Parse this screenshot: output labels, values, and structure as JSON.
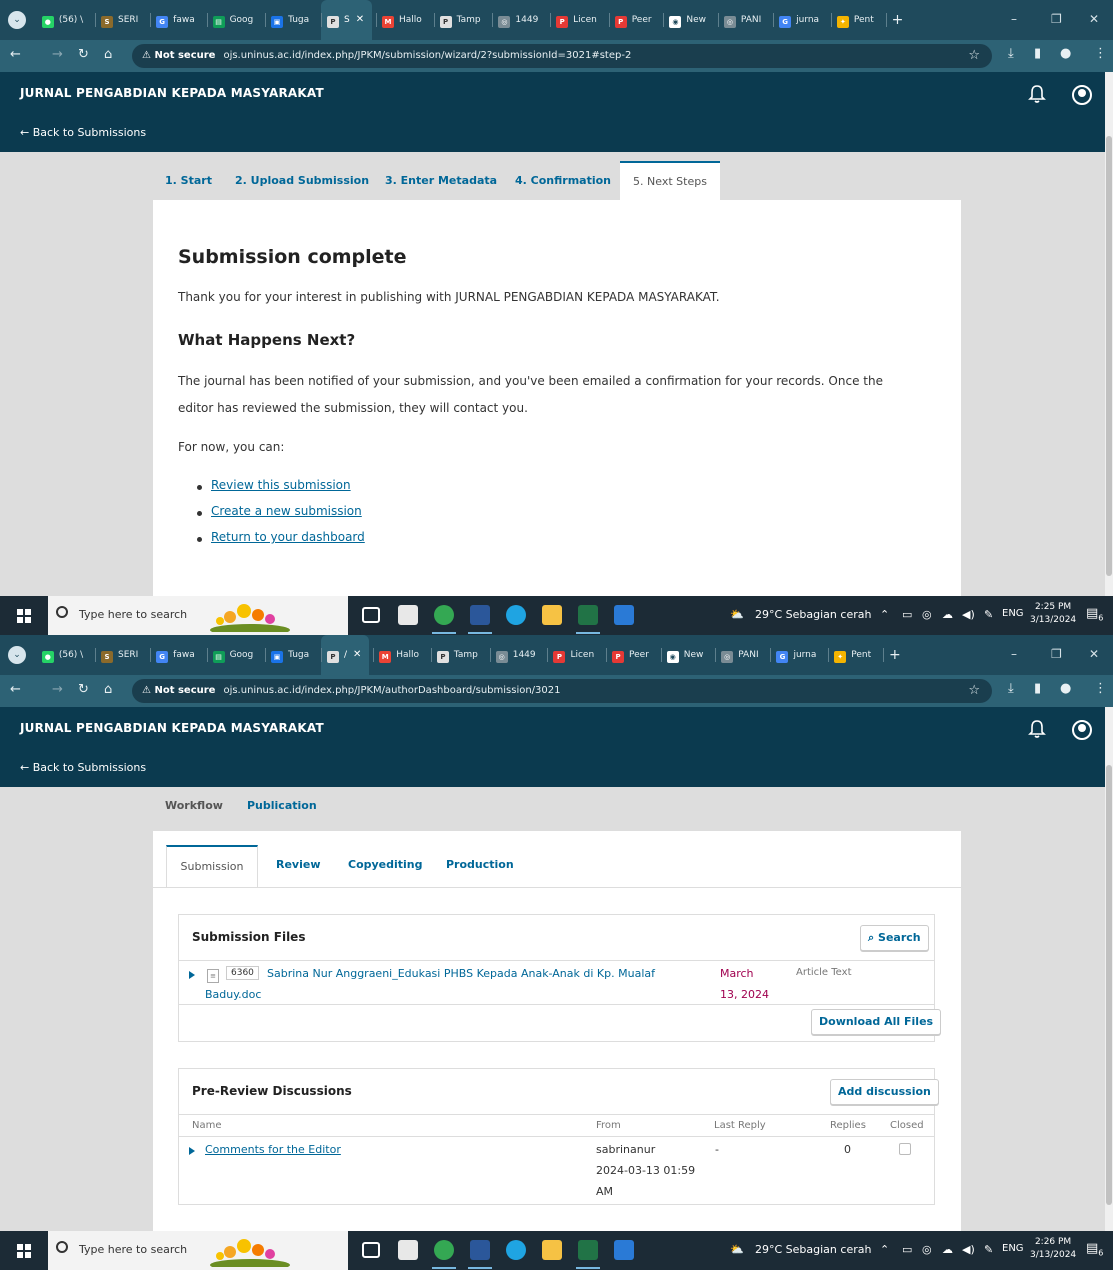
{
  "browser_tabs": [
    {
      "label": "(56) \\",
      "color": "#25d366",
      "glyph": "56"
    },
    {
      "label": "SERI",
      "color": "#8b6a2b",
      "glyph": "S"
    },
    {
      "label": "fawa",
      "color": "#4285f4",
      "glyph": "G"
    },
    {
      "label": "Goog",
      "color": "#0f9d58",
      "glyph": "G"
    },
    {
      "label": "Tuga",
      "color": "#1a73e8",
      "glyph": "T"
    },
    {
      "label": "",
      "color": "#e0e0e0",
      "glyph": "PKP",
      "active": true
    },
    {
      "label": "Hallo",
      "color": "#ea4335",
      "glyph": "M"
    },
    {
      "label": "Tamp",
      "color": "#e0e0e0",
      "glyph": "PKP"
    },
    {
      "label": "1449",
      "color": "#7a8c95",
      "glyph": "◎"
    },
    {
      "label": "Licen",
      "color": "#e53935",
      "glyph": "P"
    },
    {
      "label": "Peer",
      "color": "#e53935",
      "glyph": "P"
    },
    {
      "label": "New",
      "color": "#ffffff",
      "glyph": "◉"
    },
    {
      "label": "PANI",
      "color": "#7a8c95",
      "glyph": "◎"
    },
    {
      "label": "jurna",
      "color": "#4285f4",
      "glyph": "G"
    },
    {
      "label": "Pent",
      "color": "#f4b400",
      "glyph": "✦"
    }
  ],
  "shot1": {
    "active_tab_label": "S",
    "address": {
      "warning": "Not secure",
      "url": "ojs.uninus.ac.id/index.php/JPKM/submission/wizard/2?submissionId=3021#step-2"
    },
    "site_title": "JURNAL PENGABDIAN KEPADA MASYARAKAT",
    "back_link": "← Back to Submissions",
    "wizard_tabs": [
      "1. Start",
      "2. Upload Submission",
      "3. Enter Metadata",
      "4. Confirmation",
      "5. Next Steps"
    ],
    "heading": "Submission complete",
    "thanks": "Thank you for your interest in publishing with JURNAL PENGABDIAN KEPADA MASYARAKAT.",
    "subheading": "What Happens Next?",
    "body": "The journal has been notified of your submission, and you've been emailed a confirmation for your records. Once the editor has reviewed the submission, they will contact you.",
    "for_now": "For now, you can:",
    "links": [
      "Review this submission",
      "Create a new submission",
      "Return to your dashboard"
    ],
    "clock_time": "2:25 PM",
    "clock_date": "3/13/2024"
  },
  "shot2": {
    "active_tab_label": "/",
    "address": {
      "warning": "Not secure",
      "url": "ojs.uninus.ac.id/index.php/JPKM/authorDashboard/submission/3021"
    },
    "site_title": "JURNAL PENGABDIAN KEPADA MASYARAKAT",
    "back_link": "← Back to Submissions",
    "top_tabs": [
      "Workflow",
      "Publication"
    ],
    "stage_tabs": [
      "Submission",
      "Review",
      "Copyediting",
      "Production"
    ],
    "files": {
      "title": "Submission Files",
      "search": "Search",
      "file_id": "6360",
      "file_name_line1": "Sabrina Nur Anggraeni_Edukasi PHBS Kepada Anak-Anak di Kp. Mualaf",
      "file_name_line2": "Baduy.doc",
      "date_line1": "March",
      "date_line2": "13, 2024",
      "file_type": "Article Text",
      "download_all": "Download All Files"
    },
    "discussions": {
      "title": "Pre-Review Discussions",
      "add": "Add discussion",
      "columns": [
        "Name",
        "From",
        "Last Reply",
        "Replies",
        "Closed"
      ],
      "row": {
        "name": "Comments for the Editor",
        "from_line1": "sabrinanur",
        "from_line2": "2024-03-13 01:59",
        "from_line3": "AM",
        "last_reply": "-",
        "replies": "0"
      }
    },
    "clock_time": "2:26 PM",
    "clock_date": "3/13/2024"
  },
  "taskbar": {
    "search_placeholder": "Type here to search",
    "weather": "29°C  Sebagian cerah",
    "lang": "ENG",
    "notif_count": "6"
  },
  "colors": {
    "ojs_header": "#0b3a4f",
    "link": "#006798",
    "date": "#a0004f"
  }
}
